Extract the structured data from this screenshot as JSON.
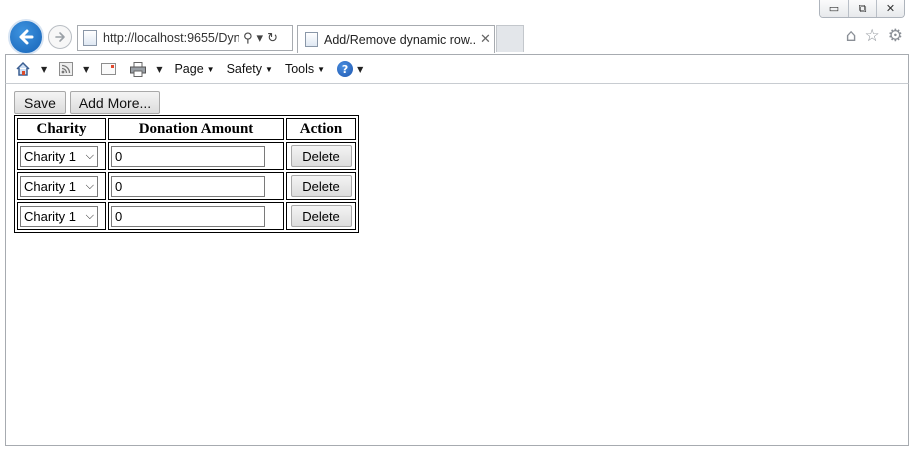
{
  "window": {
    "controls": [
      "▭",
      "⧉",
      "✕"
    ]
  },
  "browser": {
    "address": "http://localhost:9655/Dyn",
    "address_search_icon": "⚲",
    "address_dropdown_icon": "▾",
    "address_refresh_icon": "↻",
    "tab_title": "Add/Remove dynamic row...",
    "tab_close": "✕",
    "right_icons": [
      "⌂",
      "☆",
      "⚙"
    ]
  },
  "commandbar": {
    "menus": [
      {
        "label": "Page"
      },
      {
        "label": "Safety"
      },
      {
        "label": "Tools"
      }
    ],
    "help": "?"
  },
  "page": {
    "save_label": "Save",
    "add_more_label": "Add More...",
    "table": {
      "headers": [
        "Charity",
        "Donation Amount",
        "Action"
      ],
      "rows": [
        {
          "charity": "Charity 1",
          "amount": "0",
          "action": "Delete"
        },
        {
          "charity": "Charity 1",
          "amount": "0",
          "action": "Delete"
        },
        {
          "charity": "Charity 1",
          "amount": "0",
          "action": "Delete"
        }
      ]
    }
  }
}
